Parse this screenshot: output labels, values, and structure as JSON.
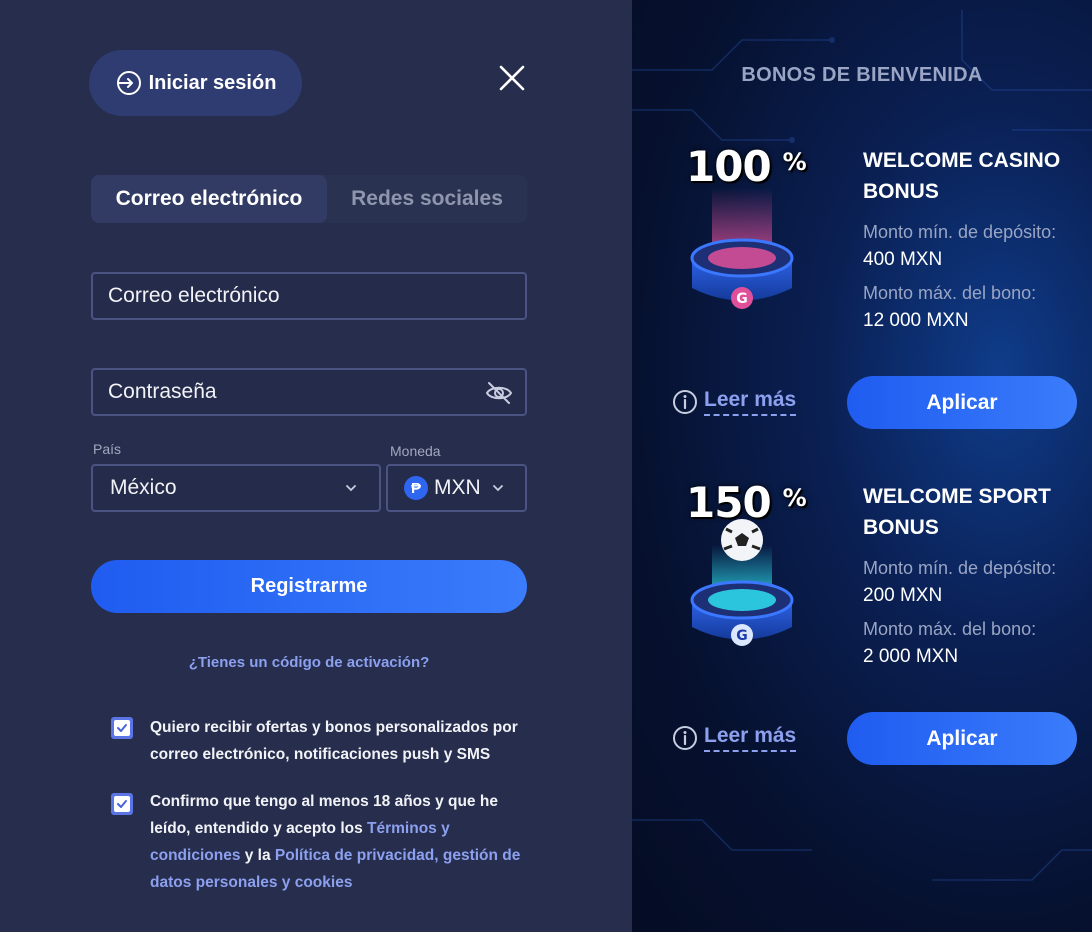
{
  "header": {
    "login_label": "Iniciar sesión"
  },
  "tabs": [
    {
      "label": "Correo electrónico",
      "active": true
    },
    {
      "label": "Redes sociales",
      "active": false
    }
  ],
  "form": {
    "email_placeholder": "Correo electrónico",
    "password_placeholder": "Contraseña",
    "country_label": "País",
    "country_value": "México",
    "currency_label": "Moneda",
    "currency_symbol": "₱",
    "currency_value": "MXN",
    "register_label": "Registrarme",
    "activation_link": "¿Tienes un código de activación?"
  },
  "checkboxes": [
    {
      "checked": true,
      "lines": [
        "Quiero recibir ofertas y bonos personalizados por",
        "correo electrónico, notificaciones push y SMS"
      ]
    },
    {
      "checked": true,
      "line1": "Confirmo que tengo al menos 18 años y que he",
      "line2_prefix": "leído, entendido y acepto los ",
      "terms_link_a": "Términos y",
      "terms_link_b": "condiciones",
      "and_text": " y la ",
      "privacy_link_a": "Política de privacidad, gestión de",
      "privacy_link_b": "datos personales y cookies"
    }
  ],
  "bonuses_panel": {
    "title": "BONOS DE BIENVENIDA",
    "items": [
      {
        "percent": "100",
        "percent_sign": "%",
        "name_line1": "WELCOME CASINO",
        "name_line2": "BONUS",
        "min_deposit_label": "Monto mín. de depósito:",
        "min_deposit_value": "400 MXN",
        "max_bonus_label": "Monto máx. del bono:",
        "max_bonus_value": "12 000 MXN",
        "read_more": "Leer más",
        "apply": "Aplicar",
        "glow_color": "#e0509a"
      },
      {
        "percent": "150",
        "percent_sign": "%",
        "name_line1": "WELCOME SPORT",
        "name_line2": "BONUS",
        "min_deposit_label": "Monto mín. de depósito:",
        "min_deposit_value": "200 MXN",
        "max_bonus_label": "Monto máx. del bono:",
        "max_bonus_value": "2 000 MXN",
        "read_more": "Leer más",
        "apply": "Aplicar",
        "glow_color": "#2ee0f0"
      }
    ]
  },
  "colors": {
    "panel_bg": "#262d4d",
    "accent_blue": "#2f66f0",
    "link": "#8ca0ef"
  }
}
